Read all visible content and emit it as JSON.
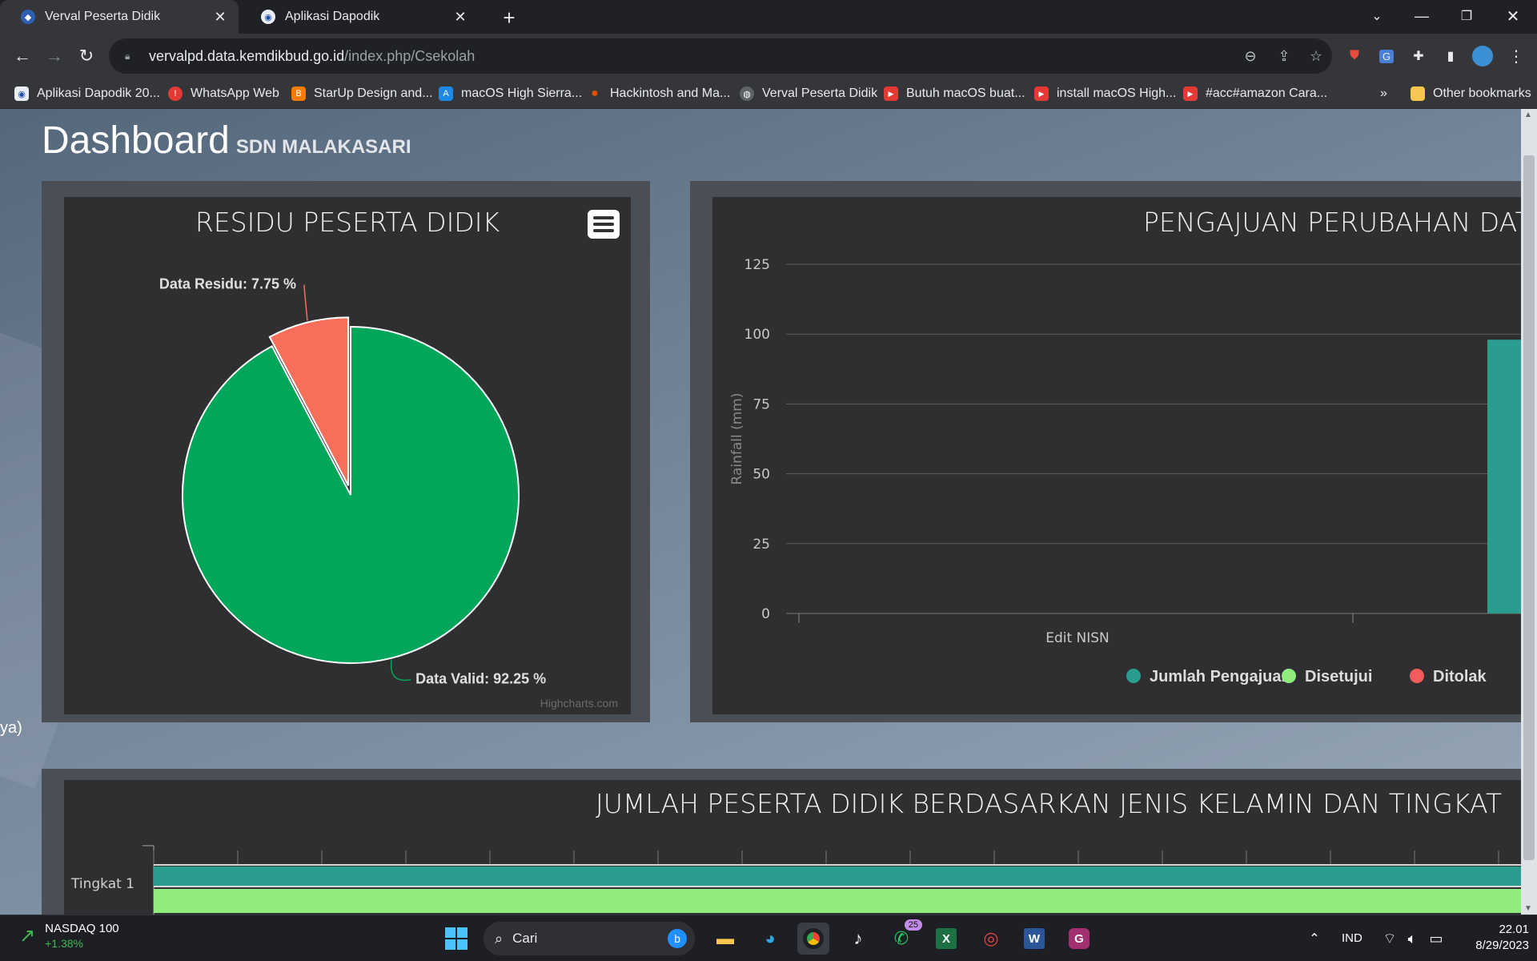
{
  "browser": {
    "tabs": [
      {
        "title": "Verval Peserta Didik",
        "active": true
      },
      {
        "title": "Aplikasi Dapodik",
        "active": false
      }
    ],
    "url_host": "vervalpd.data.kemdikbud.go.id",
    "url_path": "/index.php/Csekolah",
    "bookmarks": [
      "Aplikasi Dapodik 20...",
      "WhatsApp Web",
      "StarUp Design and...",
      "macOS High Sierra...",
      "Hackintosh and Ma...",
      "Verval Peserta Didik",
      "Butuh macOS buat...",
      "install macOS High...",
      "#acc#amazon Cara..."
    ],
    "more_bookmarks": "»",
    "other_bookmarks": "Other bookmarks"
  },
  "page": {
    "title": "Dashboard",
    "school": "SDN MALAKASARI",
    "side_text": "ya)",
    "credits": "Highcharts.com"
  },
  "chart_data": [
    {
      "type": "pie",
      "title": "RESIDU PESERTA DIDIK",
      "slices": [
        {
          "name": "Data Residu",
          "value": 7.75,
          "color": "#f76e5b",
          "label": "Data Residu: 7.75 %"
        },
        {
          "name": "Data Valid",
          "value": 92.25,
          "color": "#00a65a",
          "label": "Data Valid: 92.25 %"
        }
      ]
    },
    {
      "type": "bar",
      "title": "PENGAJUAN PERUBAHAN DATA",
      "ylabel": "Rainfall (mm)",
      "ylim": [
        0,
        125
      ],
      "yticks": [
        "0",
        "25",
        "50",
        "75",
        "100",
        "125"
      ],
      "categories": [
        "Edit NISN"
      ],
      "series": [
        {
          "name": "Jumlah Pengajuan",
          "color": "#2a9d8f",
          "values": [
            98
          ]
        },
        {
          "name": "Disetujui",
          "color": "#90ed7d",
          "values": [
            null
          ]
        },
        {
          "name": "Ditolak",
          "color": "#f45b5b",
          "values": [
            null
          ]
        }
      ],
      "legend_visible": [
        "Jumlah Pengajuan",
        "Disetujui",
        "Ditolak"
      ]
    },
    {
      "type": "bar",
      "title": "JUMLAH PESERTA DIDIK BERDASARKAN JENIS KELAMIN DAN TINGKAT",
      "categories": [
        "Tingkat 1"
      ]
    }
  ],
  "taskbar": {
    "stock_name": "NASDAQ 100",
    "stock_change": "+1.38%",
    "search_placeholder": "Cari",
    "whatsapp_badge": "25",
    "language": "IND",
    "time": "22.01",
    "date": "8/29/2023"
  }
}
